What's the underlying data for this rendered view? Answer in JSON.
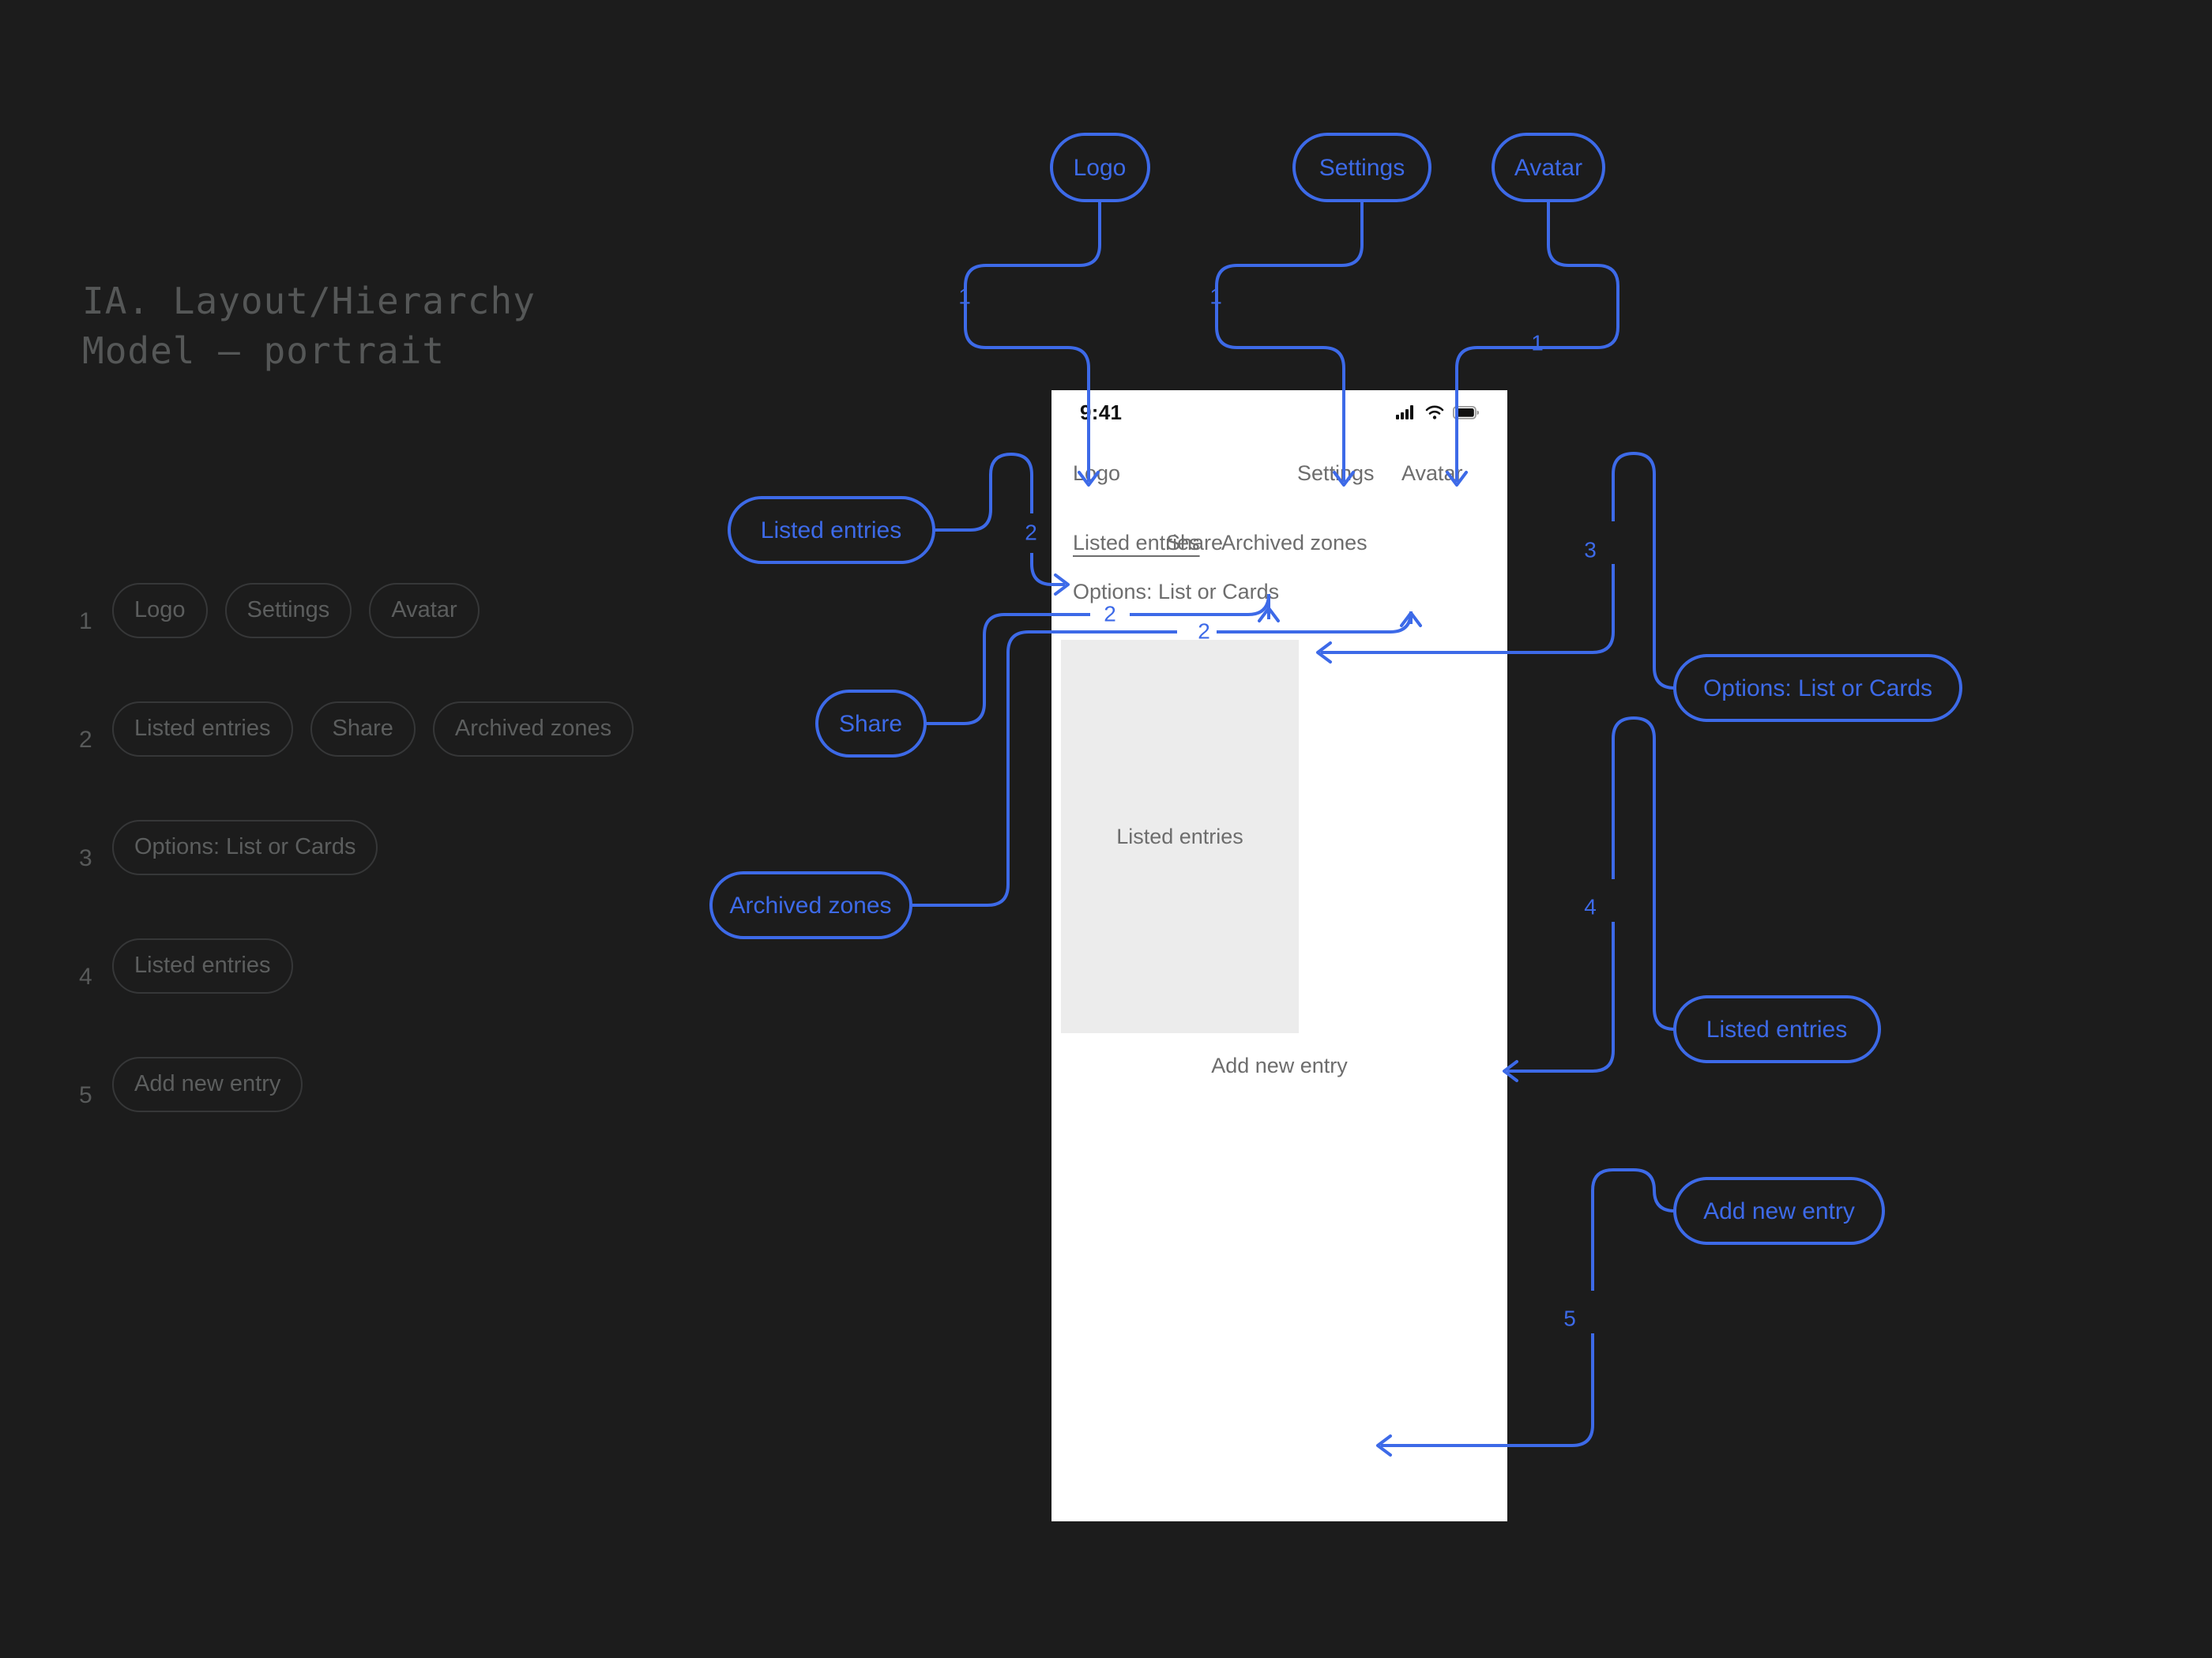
{
  "page": {
    "background_color": "#1c1c1c",
    "accent_color": "#3d6ae8",
    "title": "IA. Layout/Hierarchy\nModel — portrait"
  },
  "legend": {
    "rows": [
      {
        "number": "1",
        "items": [
          "Logo",
          "Settings",
          "Avatar"
        ]
      },
      {
        "number": "2",
        "items": [
          "Listed entries",
          "Share",
          "Archived zones"
        ]
      },
      {
        "number": "3",
        "items": [
          "Options: List or Cards"
        ]
      },
      {
        "number": "4",
        "items": [
          "Listed entries"
        ]
      },
      {
        "number": "5",
        "items": [
          "Add new entry"
        ]
      }
    ]
  },
  "phone": {
    "status_bar": {
      "time": "9:41",
      "icons": [
        "signal-icon",
        "wifi-icon",
        "battery-icon"
      ]
    },
    "header": {
      "logo": "Logo",
      "settings": "Settings",
      "avatar": "Avatar"
    },
    "tabs": [
      {
        "label": "Listed entries",
        "active": true
      },
      {
        "label": "Share",
        "active": false
      },
      {
        "label": "Archived zones",
        "active": false
      }
    ],
    "options_row": "Options: List or Cards",
    "content_label": "Listed entries",
    "add_button": "Add new entry"
  },
  "callouts": {
    "top": [
      {
        "label": "Logo",
        "number": "1"
      },
      {
        "label": "Settings",
        "number": "1"
      },
      {
        "label": "Avatar",
        "number": "1"
      }
    ],
    "left": [
      {
        "label": "Listed entries",
        "number": "2"
      },
      {
        "label": "Share",
        "number": "2"
      },
      {
        "label": "Archived zones",
        "number": "2"
      }
    ],
    "right": [
      {
        "label": "Options: List or Cards",
        "number": "3"
      },
      {
        "label": "Listed entries",
        "number": "4"
      },
      {
        "label": "Add new entry",
        "number": "5"
      }
    ]
  }
}
